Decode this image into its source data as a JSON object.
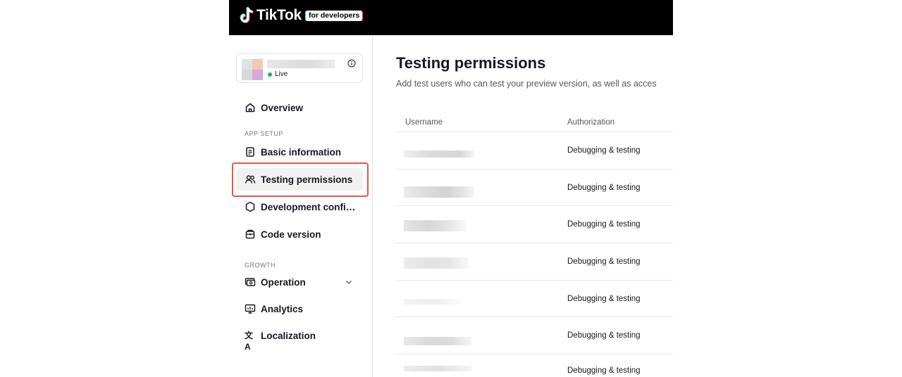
{
  "header": {
    "brand": "TikTok",
    "badge": "for developers"
  },
  "app_card": {
    "status": "Live"
  },
  "sidebar": {
    "overview": "Overview",
    "app_setup_label": "APP SETUP",
    "basic_information": "Basic information",
    "testing_permissions": "Testing permissions",
    "development_config": "Development confi…",
    "code_version": "Code version",
    "growth_label": "GROWTH",
    "operation": "Operation",
    "analytics": "Analytics",
    "localization": "Localization"
  },
  "main": {
    "title": "Testing permissions",
    "subtitle": "Add test users who can test your preview version, as well as acces",
    "columns": [
      "Username",
      "Authorization"
    ],
    "rows": [
      {
        "authorization": "Debugging & testing"
      },
      {
        "authorization": "Debugging & testing"
      },
      {
        "authorization": "Debugging & testing"
      },
      {
        "authorization": "Debugging & testing"
      },
      {
        "authorization": "Debugging & testing"
      },
      {
        "authorization": "Debugging & testing"
      },
      {
        "authorization": "Debugging & testing"
      }
    ]
  },
  "colors": {
    "header_bg": "#000000",
    "highlight": "#e5564b",
    "live_dot": "#20b35b",
    "active_bg": "#f1f1f2"
  }
}
